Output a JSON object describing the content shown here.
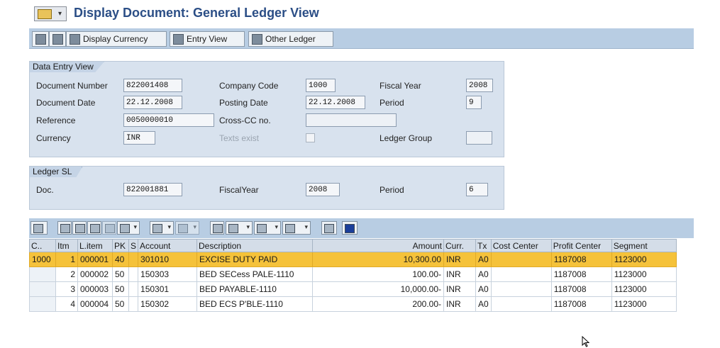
{
  "title": "Display Document: General Ledger View",
  "app_toolbar": {
    "display_currency": "Display Currency",
    "entry_view": "Entry View",
    "other_ledger": "Other Ledger"
  },
  "data_entry_view": {
    "title": "Data Entry View",
    "document_number_label": "Document Number",
    "document_number": "822001408",
    "company_code_label": "Company Code",
    "company_code": "1000",
    "fiscal_year_label": "Fiscal Year",
    "fiscal_year": "2008",
    "document_date_label": "Document Date",
    "document_date": "22.12.2008",
    "posting_date_label": "Posting Date",
    "posting_date": "22.12.2008",
    "period_label": "Period",
    "period": "9",
    "reference_label": "Reference",
    "reference": "0050000010",
    "cross_cc_label": "Cross-CC no.",
    "cross_cc": "",
    "currency_label": "Currency",
    "currency": "INR",
    "texts_exist_label": "Texts exist",
    "ledger_group_label": "Ledger Group",
    "ledger_group": ""
  },
  "ledger": {
    "title": "Ledger SL",
    "doc_label": "Doc.",
    "doc": "822001881",
    "fiscal_year_label": "FiscalYear",
    "fiscal_year": "2008",
    "period_label": "Period",
    "period": "6"
  },
  "table": {
    "headers": [
      "C..",
      "Itm",
      "L.item",
      "PK",
      "S",
      "Account",
      "Description",
      "Amount",
      "Curr.",
      "Tx",
      "Cost Center",
      "Profit Center",
      "Segment"
    ],
    "rows": [
      {
        "c": "1000",
        "itm": "1",
        "litem": "000001",
        "pk": "40",
        "s": "",
        "account": "301010",
        "desc": "EXCISE DUTY PAID",
        "amount": "10,300.00",
        "curr": "INR",
        "tx": "A0",
        "cost": "",
        "profit": "1187008",
        "segment": "1123000"
      },
      {
        "c": "",
        "itm": "2",
        "litem": "000002",
        "pk": "50",
        "s": "",
        "account": "150303",
        "desc": "BED SECess PALE-1110",
        "amount": "100.00-",
        "curr": "INR",
        "tx": "A0",
        "cost": "",
        "profit": "1187008",
        "segment": "1123000"
      },
      {
        "c": "",
        "itm": "3",
        "litem": "000003",
        "pk": "50",
        "s": "",
        "account": "150301",
        "desc": "BED PAYABLE-1110",
        "amount": "10,000.00-",
        "curr": "INR",
        "tx": "A0",
        "cost": "",
        "profit": "1187008",
        "segment": "1123000"
      },
      {
        "c": "",
        "itm": "4",
        "litem": "000004",
        "pk": "50",
        "s": "",
        "account": "150302",
        "desc": "BED ECS P'BLE-1110",
        "amount": "200.00-",
        "curr": "INR",
        "tx": "A0",
        "cost": "",
        "profit": "1187008",
        "segment": "1123000"
      }
    ]
  },
  "colors": {
    "title": "#2b4e86",
    "selected_row": "#f5c23a",
    "toolbar": "#b8cde3",
    "group_bg": "#d8e2ee"
  }
}
